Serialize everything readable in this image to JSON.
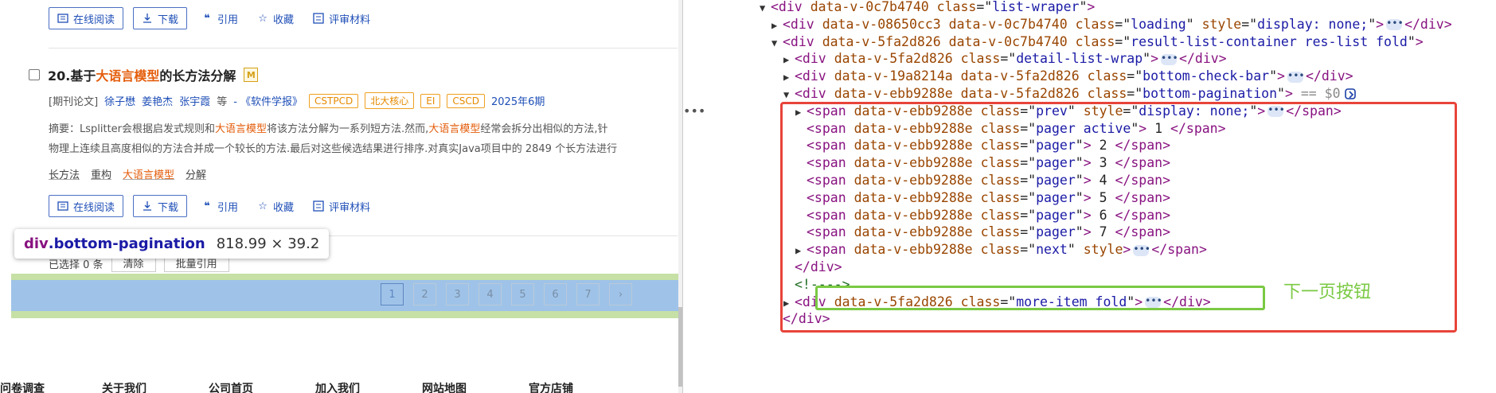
{
  "page": {
    "result_top_actions": {
      "read_online": "在线阅读",
      "download": "下载",
      "cite": "引用",
      "favorite": "收藏",
      "review": "评审材料"
    },
    "item": {
      "number": "20.",
      "title_pre": "基于",
      "title_hl": "大语言模型",
      "title_post": "的长方法分解",
      "badge": "M",
      "meta": {
        "type": "[期刊论文]",
        "authors": [
          "徐子懋",
          "姜艳杰",
          "张宇霞"
        ],
        "etal": "等",
        "journal": "- 《软件学报》",
        "tags": [
          "CSTPCD",
          "北大核心",
          "EI",
          "CSCD"
        ],
        "issue": "2025年6期"
      },
      "abstract_line1": [
        {
          "t": "摘要：Lsplitter会根据启发式规则和",
          "hl": false
        },
        {
          "t": "大语言模型",
          "hl": true
        },
        {
          "t": "将该方法分解为一系列短方法.然而,",
          "hl": false
        },
        {
          "t": "大语言模型",
          "hl": true
        },
        {
          "t": "经常会拆分出相似的方法,针",
          "hl": false
        }
      ],
      "abstract_line2": "物理上连续且高度相似的方法合并成一个较长的方法.最后对这些候选结果进行排序.对真实Java项目中的 2849 个长方法进行",
      "keywords": [
        {
          "t": "长方法",
          "hl": false
        },
        {
          "t": "重构",
          "hl": false
        },
        {
          "t": "大语言模型",
          "hl": true
        },
        {
          "t": "分解",
          "hl": false
        }
      ]
    },
    "tooltip": {
      "selector_tag": "div",
      "selector_class": ".bottom-pagination",
      "dims": "818.99 × 39.2"
    },
    "bottom_check": {
      "selected": "已选择 0 条",
      "clear": "清除",
      "batch_cite": "批量引用"
    },
    "pagination": {
      "pages": [
        "1",
        "2",
        "3",
        "4",
        "5",
        "6",
        "7"
      ],
      "active": "1",
      "next": "›"
    },
    "footer": [
      "问卷调查",
      "关于我们",
      "公司首页",
      "加入我们",
      "网站地图",
      "官方店铺"
    ]
  },
  "devtools": {
    "dots": "•••",
    "dollar": "== $0",
    "annotation": "下一页按钮",
    "lines": [
      {
        "indent": 0,
        "tri": "▼",
        "html": "div",
        "attrs": [
          [
            "data-v-0c7b4740",
            null
          ],
          [
            "class",
            "list-wraper"
          ]
        ],
        "close": false,
        "tail": ""
      },
      {
        "indent": 1,
        "tri": "▶",
        "html": "div",
        "attrs": [
          [
            "data-v-08650cc3",
            null
          ],
          [
            "data-v-0c7b4740",
            null
          ],
          [
            "class",
            "loading"
          ],
          [
            "style",
            "display: none;"
          ]
        ],
        "close": true,
        "tail": ""
      },
      {
        "indent": 1,
        "tri": "▼",
        "html": "div",
        "attrs": [
          [
            "data-v-5fa2d826",
            null
          ],
          [
            "data-v-0c7b4740",
            null
          ],
          [
            "class",
            "result-list-container res-list fold"
          ]
        ],
        "close": false,
        "tail": ""
      },
      {
        "indent": 2,
        "tri": "▶",
        "html": "div",
        "attrs": [
          [
            "data-v-5fa2d826",
            null
          ],
          [
            "class",
            "detail-list-wrap"
          ]
        ],
        "close": true,
        "tail": ""
      },
      {
        "indent": 2,
        "tri": "▶",
        "html": "div",
        "attrs": [
          [
            "data-v-19a8214a",
            null
          ],
          [
            "data-v-5fa2d826",
            null
          ],
          [
            "class",
            "bottom-check-bar"
          ]
        ],
        "close": true,
        "tail": ""
      },
      {
        "indent": 2,
        "tri": "▼",
        "html": "div",
        "attrs": [
          [
            "data-v-ebb9288e",
            null
          ],
          [
            "data-v-5fa2d826",
            null
          ],
          [
            "class",
            "bottom-pagination"
          ]
        ],
        "close": false,
        "tail": "",
        "selected": true
      },
      {
        "indent": 3,
        "tri": "▶",
        "html": "span",
        "attrs": [
          [
            "data-v-ebb9288e",
            null
          ],
          [
            "class",
            "prev"
          ],
          [
            "style",
            "display: none;"
          ]
        ],
        "close": true,
        "tail": ""
      },
      {
        "indent": 3,
        "tri": "",
        "html": "span",
        "attrs": [
          [
            "data-v-ebb9288e",
            null
          ],
          [
            "class",
            "pager active"
          ]
        ],
        "close": false,
        "text": " 1 ",
        "endtag": "span"
      },
      {
        "indent": 3,
        "tri": "",
        "html": "span",
        "attrs": [
          [
            "data-v-ebb9288e",
            null
          ],
          [
            "class",
            "pager"
          ]
        ],
        "close": false,
        "text": " 2 ",
        "endtag": "span"
      },
      {
        "indent": 3,
        "tri": "",
        "html": "span",
        "attrs": [
          [
            "data-v-ebb9288e",
            null
          ],
          [
            "class",
            "pager"
          ]
        ],
        "close": false,
        "text": " 3 ",
        "endtag": "span"
      },
      {
        "indent": 3,
        "tri": "",
        "html": "span",
        "attrs": [
          [
            "data-v-ebb9288e",
            null
          ],
          [
            "class",
            "pager"
          ]
        ],
        "close": false,
        "text": " 4 ",
        "endtag": "span"
      },
      {
        "indent": 3,
        "tri": "",
        "html": "span",
        "attrs": [
          [
            "data-v-ebb9288e",
            null
          ],
          [
            "class",
            "pager"
          ]
        ],
        "close": false,
        "text": " 5 ",
        "endtag": "span"
      },
      {
        "indent": 3,
        "tri": "",
        "html": "span",
        "attrs": [
          [
            "data-v-ebb9288e",
            null
          ],
          [
            "class",
            "pager"
          ]
        ],
        "close": false,
        "text": " 6 ",
        "endtag": "span"
      },
      {
        "indent": 3,
        "tri": "",
        "html": "span",
        "attrs": [
          [
            "data-v-ebb9288e",
            null
          ],
          [
            "class",
            "pager"
          ]
        ],
        "close": false,
        "text": " 7 ",
        "endtag": "span"
      },
      {
        "indent": 3,
        "tri": "▶",
        "html": "span",
        "attrs": [
          [
            "data-v-ebb9288e",
            null
          ],
          [
            "class",
            "next"
          ],
          [
            "style",
            null
          ]
        ],
        "close": true,
        "tail": ""
      },
      {
        "indent": 2,
        "tri": "",
        "endonly": "div"
      },
      {
        "indent": 2,
        "tri": "",
        "comment": "<!---->"
      },
      {
        "indent": 2,
        "tri": "▶",
        "html": "div",
        "attrs": [
          [
            "data-v-5fa2d826",
            null
          ],
          [
            "class",
            "more-item fold"
          ]
        ],
        "close": true,
        "tail": ""
      },
      {
        "indent": 1,
        "tri": "",
        "endonly": "div"
      }
    ]
  },
  "colors": {
    "highlight": "#e45d0c",
    "link": "#1f4fb7",
    "red_box": "#e8443a",
    "green_box": "#7ac943"
  }
}
